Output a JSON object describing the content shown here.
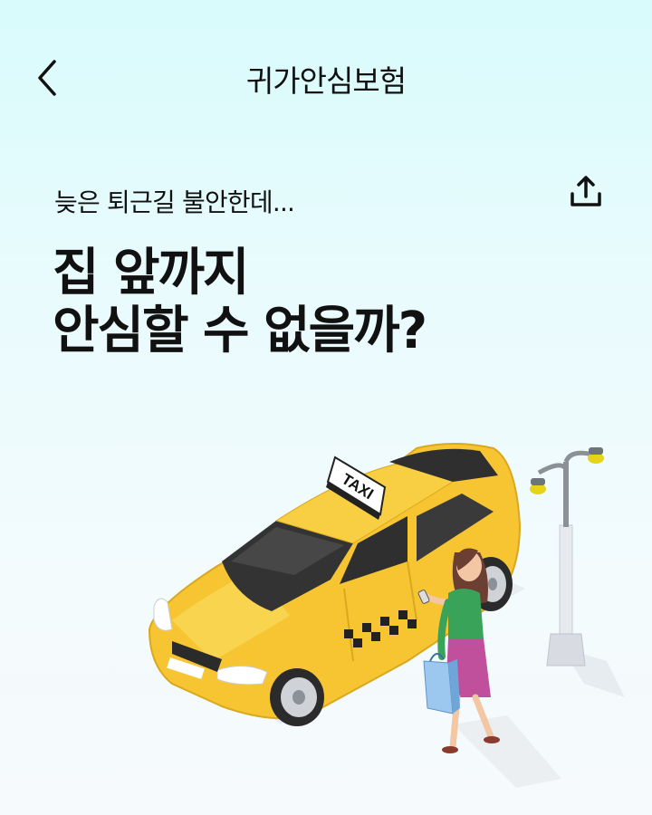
{
  "header": {
    "title": "귀가안심보험",
    "back_icon": "chevron-left-icon",
    "share_icon": "share-icon"
  },
  "hero": {
    "subtitle": "늦은 퇴근길 불안한데...",
    "headline_line1": "집 앞까지",
    "headline_line2": "안심할 수 없을까?"
  },
  "illustration": {
    "taxi_sign": "TAXI",
    "taxi_color": "#f6c531",
    "person_top_color": "#3aa35a",
    "person_skirt_color": "#c04f9c",
    "bag_color": "#7fb6e8"
  }
}
